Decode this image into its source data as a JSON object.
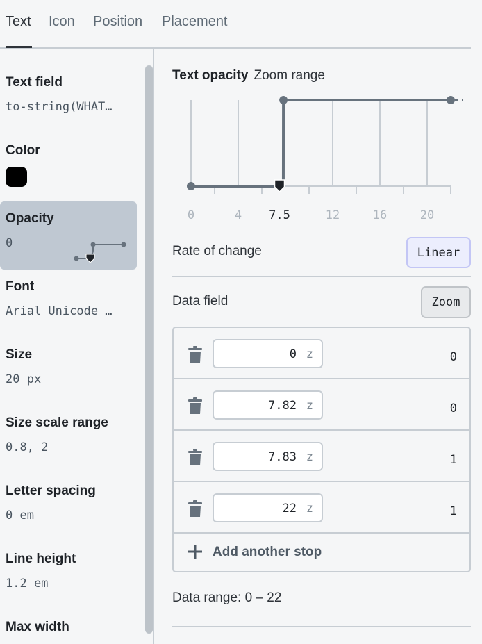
{
  "tabs": [
    {
      "label": "Text",
      "active": true
    },
    {
      "label": "Icon",
      "active": false
    },
    {
      "label": "Position",
      "active": false
    },
    {
      "label": "Placement",
      "active": false
    }
  ],
  "sidebar": {
    "items": [
      {
        "label": "Text field",
        "value": "to-string(WHAT…"
      },
      {
        "label": "Color",
        "value": "",
        "swatch": "#000000"
      },
      {
        "label": "Opacity",
        "value": "0",
        "selected": true
      },
      {
        "label": "Font",
        "value": "Arial Unicode …"
      },
      {
        "label": "Size",
        "value": "20 px"
      },
      {
        "label": "Size scale range",
        "value": "0.8, 2"
      },
      {
        "label": "Letter spacing",
        "value": "0 em"
      },
      {
        "label": "Line height",
        "value": "1.2 em"
      },
      {
        "label": "Max width",
        "value": ""
      }
    ]
  },
  "main": {
    "title": "Text opacity",
    "subtitle": "Zoom range",
    "rate_label": "Rate of change",
    "rate_button": "Linear",
    "data_field_label": "Data field",
    "data_field_button": "Zoom",
    "stops": [
      {
        "input": "0",
        "unit": "z",
        "output": "0"
      },
      {
        "input": "7.82",
        "unit": "z",
        "output": "0"
      },
      {
        "input": "7.83",
        "unit": "z",
        "output": "1"
      },
      {
        "input": "22",
        "unit": "z",
        "output": "1"
      }
    ],
    "add_stop_label": "Add another stop",
    "data_range": "Data range: 0 – 22"
  },
  "chart_data": {
    "type": "line",
    "x_ticks": [
      "0",
      "4",
      "7.5",
      "12",
      "16",
      "20"
    ],
    "highlighted_tick": "7.5",
    "xlim": [
      0,
      22
    ],
    "ylim": [
      0,
      1
    ],
    "grid": true,
    "series": [
      {
        "x": [
          0,
          7.82,
          7.83,
          22
        ],
        "y": [
          0,
          0,
          1,
          1
        ]
      }
    ],
    "current_zoom": 7.5,
    "colors": {
      "line": "#67727d",
      "grid": "#c7cdd3",
      "marker": "#1f2328"
    }
  }
}
